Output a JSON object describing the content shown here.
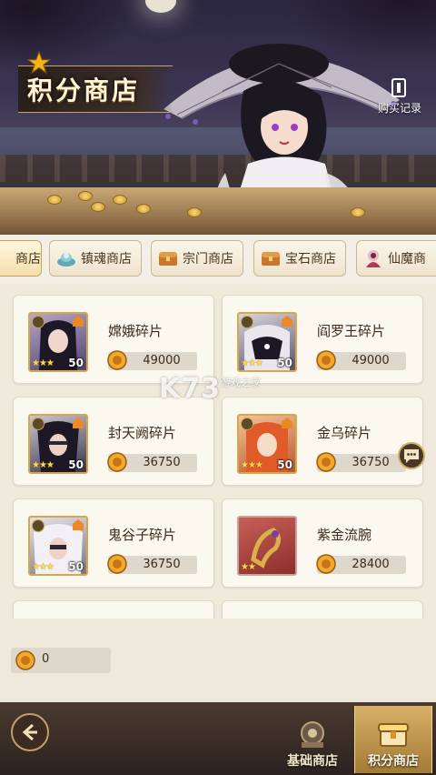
{
  "header": {
    "title": "积分商店",
    "history_label": "购买记录"
  },
  "tabs": [
    {
      "label": "商店",
      "icon": "shop-icon",
      "active": true
    },
    {
      "label": "镇魂商店",
      "icon": "soul-lamp-icon"
    },
    {
      "label": "宗门商店",
      "icon": "treasure-chest-icon"
    },
    {
      "label": "宝石商店",
      "icon": "treasure-chest-icon"
    },
    {
      "label": "仙魔商",
      "icon": "immortal-demon-icon"
    }
  ],
  "items": [
    {
      "name": "嫦娥碎片",
      "price": "49000",
      "stars": 3,
      "level": "50",
      "portrait": "hero-portrait"
    },
    {
      "name": "阎罗王碎片",
      "price": "49000",
      "stars": 3,
      "level": "50",
      "portrait": "hero-portrait"
    },
    {
      "name": "封天阙碎片",
      "price": "36750",
      "stars": 3,
      "level": "50",
      "portrait": "hero-portrait"
    },
    {
      "name": "金乌碎片",
      "price": "36750",
      "stars": 3,
      "level": "50",
      "portrait": "hero-portrait"
    },
    {
      "name": "鬼谷子碎片",
      "price": "36750",
      "stars": 3,
      "level": "50",
      "portrait": "hero-portrait"
    },
    {
      "name": "紫金流腕",
      "price": "28400",
      "stars": 2,
      "level": "",
      "portrait": "bracelet-item"
    }
  ],
  "balance": {
    "value": "0"
  },
  "watermark": {
    "text": "K73",
    "sub": "游戏之家"
  },
  "bottom_nav": [
    {
      "label": "基础商店",
      "icon": "basic-shop-icon"
    },
    {
      "label": "积分商店",
      "icon": "points-shop-icon",
      "active": true
    }
  ],
  "colors": {
    "accent_gold": "#d4a94a",
    "background": "#efe9dc",
    "bottom_bar": "#3a2d26"
  }
}
